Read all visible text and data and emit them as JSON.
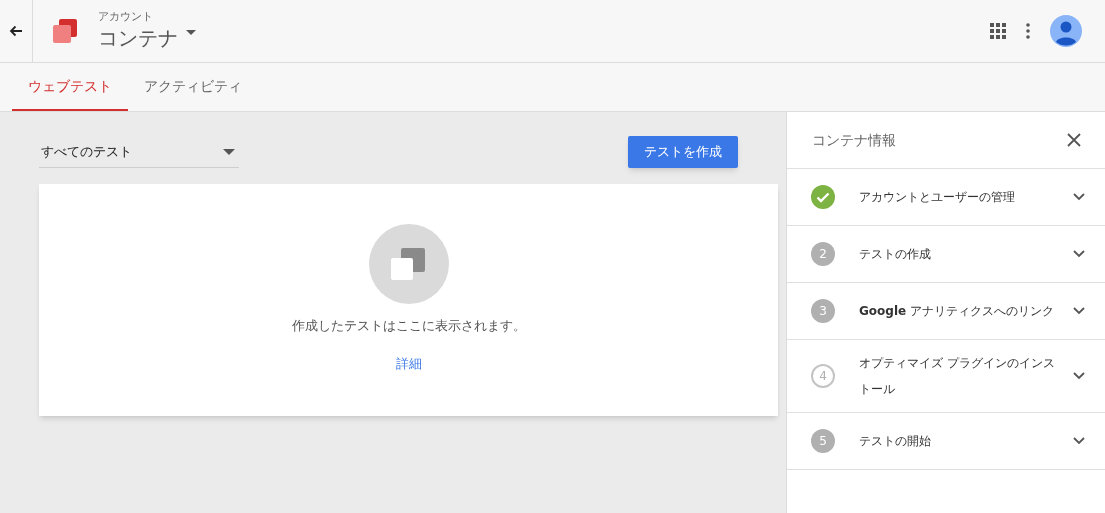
{
  "header": {
    "account_label": "アカウント",
    "container_name": "コンテナ"
  },
  "tabs": [
    {
      "label": "ウェブテスト",
      "selected": true
    },
    {
      "label": "アクティビティ",
      "selected": false
    }
  ],
  "filter": {
    "value": "すべてのテスト"
  },
  "create_button": "テストを作成",
  "empty_state": {
    "message": "作成したテストはここに表示されます。",
    "link": "詳細"
  },
  "panel": {
    "title": "コンテナ情報",
    "steps": [
      {
        "kind": "done",
        "label": "アカウントとユーザーの管理"
      },
      {
        "kind": "pending",
        "number": "2",
        "label": "テストの作成"
      },
      {
        "kind": "pending",
        "number": "3",
        "label": "**Google** アナリティクスへのリンク"
      },
      {
        "kind": "current",
        "number": "4",
        "label": "オプティマイズ プラグインのインストール"
      },
      {
        "kind": "pending",
        "number": "5",
        "label": "テストの開始"
      }
    ]
  }
}
